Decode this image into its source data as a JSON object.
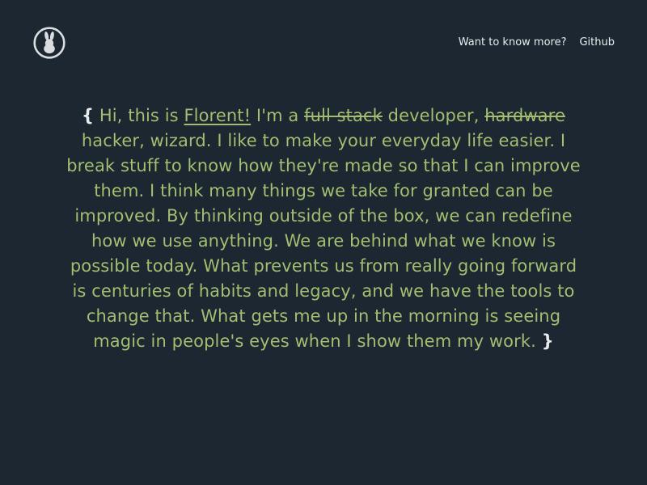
{
  "header": {
    "logo_icon": "rabbit-icon",
    "nav": [
      {
        "label": "Want to know more?"
      },
      {
        "label": "Github"
      }
    ]
  },
  "bio": {
    "open_brace": "{",
    "greeting": "Hi, this is",
    "name": "Florent!",
    "im_a": "I'm a",
    "struck_1": "full-stack",
    "after_struck_1": "developer,",
    "struck_2": "hardware",
    "body": "hacker, wizard. I like to make your everyday life easier. I break stuff to know how they're made so that I can improve them. I think many things we take for granted can be improved. By thinking outside of the box, we can redefine how we use anything. We are behind what we know is possible today. What prevents us from really going forward is centuries of habits and legacy, and we have the tools to change that. What gets me up in the morning is seeing magic in people's eyes when I show them my work.",
    "close_brace": "}"
  },
  "colors": {
    "background": "#1c2731",
    "accent_green": "#a3bd71",
    "foreground": "#e8ecef"
  }
}
